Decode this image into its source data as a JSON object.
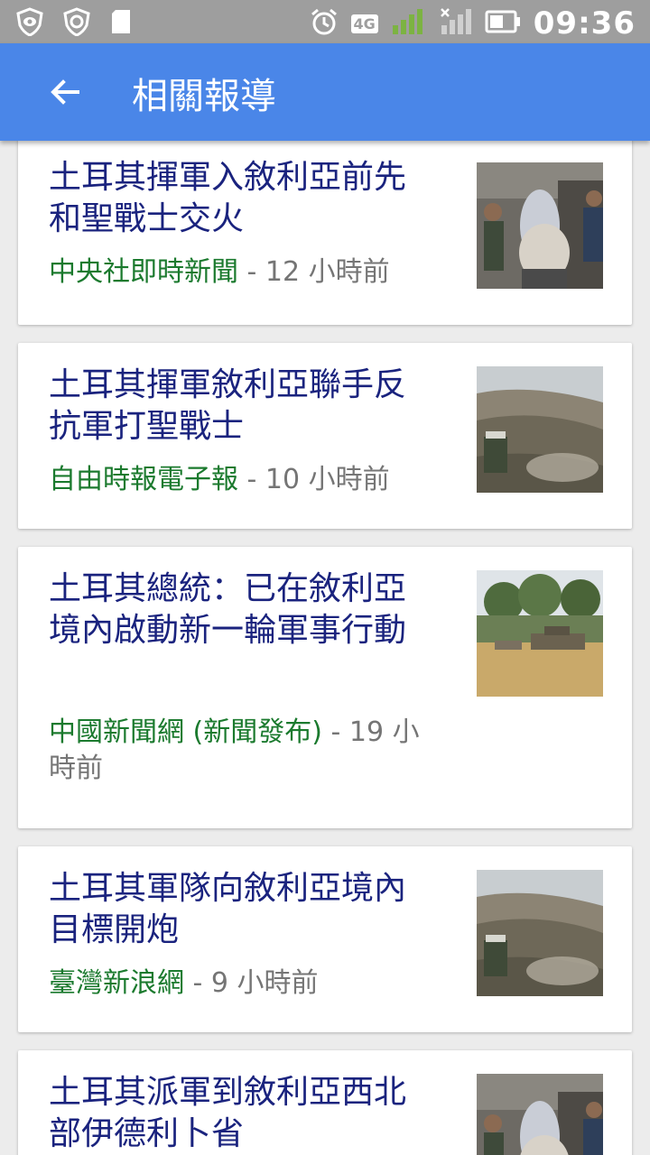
{
  "status_bar": {
    "time": "09:36",
    "network": "4G"
  },
  "app_bar": {
    "title": "相關報導"
  },
  "articles": [
    {
      "title": "土耳其揮軍入敘利亞前先和聖戰士交火",
      "source": "中央社即時新聞",
      "age": "- 12 小時前",
      "thumb_icon": "news-photo-soldiers"
    },
    {
      "title": "土耳其揮軍敘利亞聯手反抗軍打聖戰士",
      "source": "自由時報電子報",
      "age": "- 10 小時前",
      "thumb_icon": "news-photo-hillside"
    },
    {
      "title": "土耳其總統：已在敘利亞境內啟動新一輪軍事行動",
      "source": "中國新聞網 (新聞發布)",
      "age": "- 19 小時前",
      "thumb_icon": "news-photo-tank"
    },
    {
      "title": "土耳其軍隊向敘利亞境內目標開炮",
      "source": "臺灣新浪網",
      "age": "- 9 小時前",
      "thumb_icon": "news-photo-hillside"
    },
    {
      "title": "土耳其派軍到敘利亞西北部伊德利卜省",
      "source": "",
      "age": "",
      "thumb_icon": "news-photo-soldiers"
    }
  ],
  "colors": {
    "app_bar": "#4a86e8",
    "title": "#1a237e",
    "source": "#1b7a2e",
    "meta": "#757575"
  }
}
